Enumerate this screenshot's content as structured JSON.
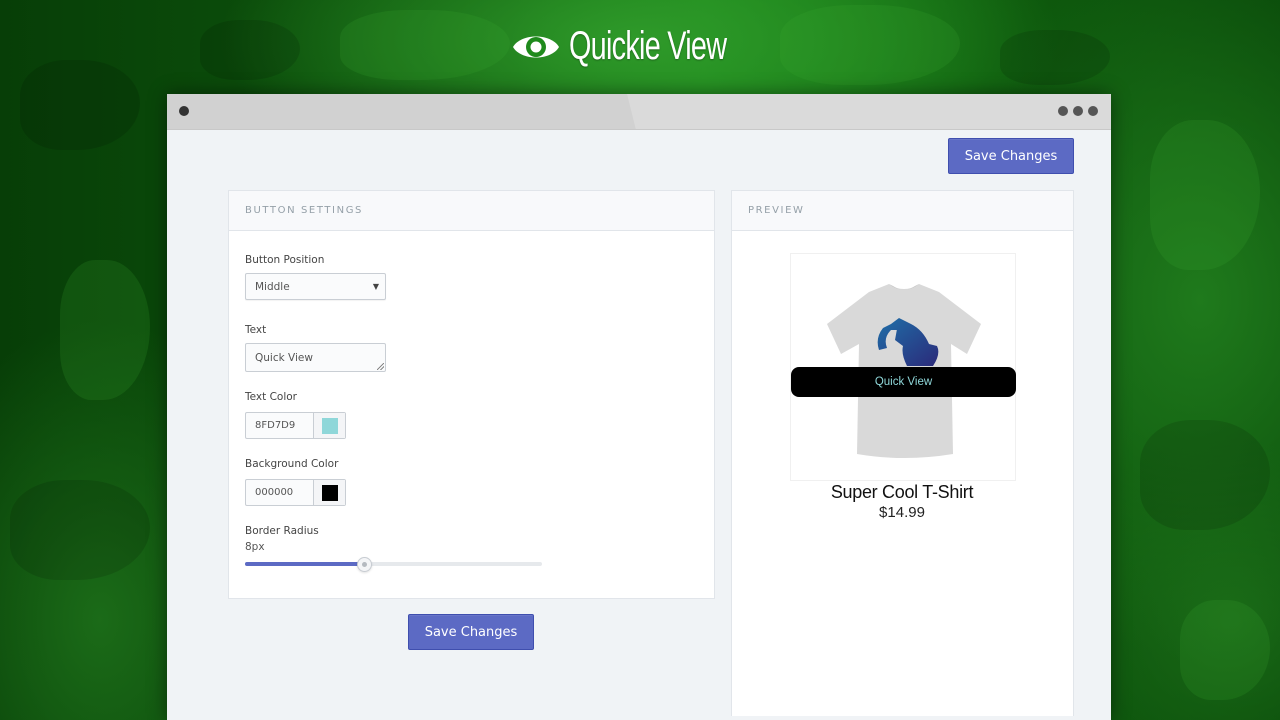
{
  "logo": {
    "icon": "eye-icon",
    "text": "Quickie View"
  },
  "browser": {
    "menu_icon": "more-dots-icon"
  },
  "toolbar": {
    "save_label": "Save Changes"
  },
  "settings": {
    "header": "BUTTON SETTINGS",
    "position": {
      "label": "Button Position",
      "value": "Middle"
    },
    "text": {
      "label": "Text",
      "value": "Quick View"
    },
    "text_color": {
      "label": "Text Color",
      "value": "8FD7D9",
      "swatch": "#8FD7D9"
    },
    "background_color": {
      "label": "Background Color",
      "value": "000000",
      "swatch": "#000000"
    },
    "border_radius": {
      "label": "Border Radius",
      "value_text": "8px",
      "value": 8,
      "max": 20
    },
    "save_label": "Save Changes"
  },
  "preview": {
    "header": "PREVIEW",
    "quick_view_label": "Quick View",
    "product_title": "Super Cool T-Shirt",
    "product_price": "$14.99"
  },
  "colors": {
    "accent": "#5C6AC4",
    "quick_view_text": "#8FD7D9",
    "quick_view_bg": "#000000"
  }
}
